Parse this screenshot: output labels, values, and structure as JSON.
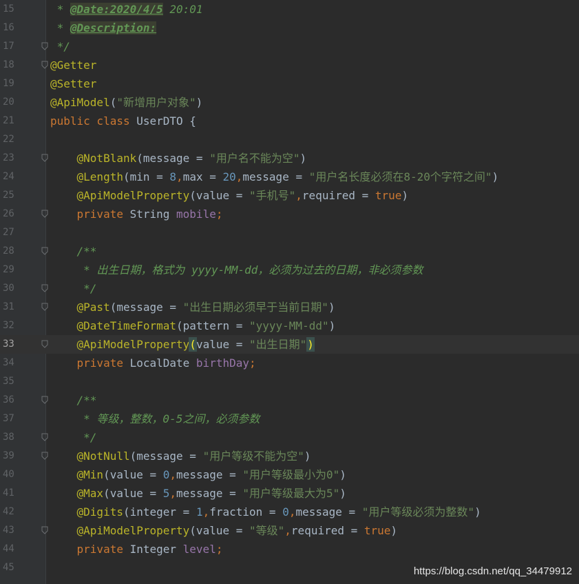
{
  "editor": {
    "current_line": "33",
    "lines": [
      {
        "n": "15",
        "t": [
          [
            "cmt",
            " * "
          ],
          [
            "tag",
            "@Date:2020/4/5"
          ],
          [
            "cmt",
            " 20:01"
          ]
        ]
      },
      {
        "n": "16",
        "t": [
          [
            "cmt",
            " * "
          ],
          [
            "tag",
            "@Description:"
          ]
        ]
      },
      {
        "n": "17",
        "t": [
          [
            "cmt",
            " */"
          ]
        ]
      },
      {
        "n": "18",
        "t": [
          [
            "ann",
            "@Getter"
          ]
        ]
      },
      {
        "n": "19",
        "t": [
          [
            "ann",
            "@Setter"
          ]
        ]
      },
      {
        "n": "20",
        "t": [
          [
            "ann",
            "@ApiModel"
          ],
          [
            "plain",
            "("
          ],
          [
            "str",
            "\"新增用户对象\""
          ],
          [
            "plain",
            ")"
          ]
        ]
      },
      {
        "n": "21",
        "t": [
          [
            "kw",
            "public class "
          ],
          [
            "plain",
            "UserDTO {"
          ]
        ]
      },
      {
        "n": "22",
        "t": []
      },
      {
        "n": "23",
        "t": [
          [
            "plain",
            "    "
          ],
          [
            "ann",
            "@NotBlank"
          ],
          [
            "plain",
            "(message = "
          ],
          [
            "str",
            "\"用户名不能为空\""
          ],
          [
            "plain",
            ")"
          ]
        ]
      },
      {
        "n": "24",
        "t": [
          [
            "plain",
            "    "
          ],
          [
            "ann",
            "@Length"
          ],
          [
            "plain",
            "(min = "
          ],
          [
            "num",
            "8"
          ],
          [
            "kw",
            ","
          ],
          [
            "plain",
            "max = "
          ],
          [
            "num",
            "20"
          ],
          [
            "kw",
            ","
          ],
          [
            "plain",
            "message = "
          ],
          [
            "str",
            "\"用户名长度必须在8-20个字符之间\""
          ],
          [
            "plain",
            ")"
          ]
        ]
      },
      {
        "n": "25",
        "t": [
          [
            "plain",
            "    "
          ],
          [
            "ann",
            "@ApiModelProperty"
          ],
          [
            "plain",
            "(value = "
          ],
          [
            "str",
            "\"手机号\""
          ],
          [
            "kw",
            ","
          ],
          [
            "plain",
            "required = "
          ],
          [
            "kw",
            "true"
          ],
          [
            "plain",
            ")"
          ]
        ]
      },
      {
        "n": "26",
        "t": [
          [
            "plain",
            "    "
          ],
          [
            "kw",
            "private "
          ],
          [
            "plain",
            "String "
          ],
          [
            "fld",
            "mobile"
          ],
          [
            "kw",
            ";"
          ]
        ]
      },
      {
        "n": "27",
        "t": []
      },
      {
        "n": "28",
        "t": [
          [
            "plain",
            "    "
          ],
          [
            "cmt",
            "/**"
          ]
        ]
      },
      {
        "n": "29",
        "t": [
          [
            "plain",
            "    "
          ],
          [
            "cmt",
            " * 出生日期，格式为 yyyy-MM-dd，必须为过去的日期，非必须参数"
          ]
        ]
      },
      {
        "n": "30",
        "t": [
          [
            "plain",
            "    "
          ],
          [
            "cmt",
            " */"
          ]
        ]
      },
      {
        "n": "31",
        "t": [
          [
            "plain",
            "    "
          ],
          [
            "ann",
            "@Past"
          ],
          [
            "plain",
            "(message = "
          ],
          [
            "str",
            "\"出生日期必须早于当前日期\""
          ],
          [
            "plain",
            ")"
          ]
        ]
      },
      {
        "n": "32",
        "t": [
          [
            "plain",
            "    "
          ],
          [
            "ann",
            "@DateTimeFormat"
          ],
          [
            "plain",
            "(pattern = "
          ],
          [
            "str",
            "\"yyyy-MM-dd\""
          ],
          [
            "plain",
            ")"
          ]
        ]
      },
      {
        "n": "33",
        "t": [
          [
            "plain",
            "    "
          ],
          [
            "ann",
            "@ApiModelProperty"
          ],
          [
            "brace",
            "("
          ],
          [
            "plain",
            "value = "
          ],
          [
            "str",
            "\"出生日期\""
          ],
          [
            "caret",
            ""
          ],
          [
            "brace",
            ")"
          ]
        ]
      },
      {
        "n": "34",
        "t": [
          [
            "plain",
            "    "
          ],
          [
            "kw",
            "private "
          ],
          [
            "plain",
            "LocalDate "
          ],
          [
            "fld",
            "birthDay"
          ],
          [
            "kw",
            ";"
          ]
        ]
      },
      {
        "n": "35",
        "t": []
      },
      {
        "n": "36",
        "t": [
          [
            "plain",
            "    "
          ],
          [
            "cmt",
            "/**"
          ]
        ]
      },
      {
        "n": "37",
        "t": [
          [
            "plain",
            "    "
          ],
          [
            "cmt",
            " * 等级，整数，0-5之间，必须参数"
          ]
        ]
      },
      {
        "n": "38",
        "t": [
          [
            "plain",
            "    "
          ],
          [
            "cmt",
            " */"
          ]
        ]
      },
      {
        "n": "39",
        "t": [
          [
            "plain",
            "    "
          ],
          [
            "ann",
            "@NotNull"
          ],
          [
            "plain",
            "(message = "
          ],
          [
            "str",
            "\"用户等级不能为空\""
          ],
          [
            "plain",
            ")"
          ]
        ]
      },
      {
        "n": "40",
        "t": [
          [
            "plain",
            "    "
          ],
          [
            "ann",
            "@Min"
          ],
          [
            "plain",
            "(value = "
          ],
          [
            "num",
            "0"
          ],
          [
            "kw",
            ","
          ],
          [
            "plain",
            "message = "
          ],
          [
            "str",
            "\"用户等级最小为0\""
          ],
          [
            "plain",
            ")"
          ]
        ]
      },
      {
        "n": "41",
        "t": [
          [
            "plain",
            "    "
          ],
          [
            "ann",
            "@Max"
          ],
          [
            "plain",
            "(value = "
          ],
          [
            "num",
            "5"
          ],
          [
            "kw",
            ","
          ],
          [
            "plain",
            "message = "
          ],
          [
            "str",
            "\"用户等级最大为5\""
          ],
          [
            "plain",
            ")"
          ]
        ]
      },
      {
        "n": "42",
        "t": [
          [
            "plain",
            "    "
          ],
          [
            "ann",
            "@Digits"
          ],
          [
            "plain",
            "(integer = "
          ],
          [
            "num",
            "1"
          ],
          [
            "kw",
            ","
          ],
          [
            "plain",
            "fraction = "
          ],
          [
            "num",
            "0"
          ],
          [
            "kw",
            ","
          ],
          [
            "plain",
            "message = "
          ],
          [
            "str",
            "\"用户等级必须为整数\""
          ],
          [
            "plain",
            ")"
          ]
        ]
      },
      {
        "n": "43",
        "t": [
          [
            "plain",
            "    "
          ],
          [
            "ann",
            "@ApiModelProperty"
          ],
          [
            "plain",
            "(value = "
          ],
          [
            "str",
            "\"等级\""
          ],
          [
            "kw",
            ","
          ],
          [
            "plain",
            "required = "
          ],
          [
            "kw",
            "true"
          ],
          [
            "plain",
            ")"
          ]
        ]
      },
      {
        "n": "44",
        "t": [
          [
            "plain",
            "    "
          ],
          [
            "kw",
            "private "
          ],
          [
            "plain",
            "Integer "
          ],
          [
            "fld",
            "level"
          ],
          [
            "kw",
            ";"
          ]
        ]
      },
      {
        "n": "45",
        "t": []
      }
    ],
    "fold_markers": [
      "17",
      "18",
      "23",
      "26",
      "28",
      "30",
      "31",
      "33",
      "36",
      "38",
      "39",
      "43"
    ]
  },
  "watermark": "https://blog.csdn.net/qq_34479912",
  "colors": {
    "background": "#2b2b2b",
    "gutter": "#313335",
    "annotation": "#bbb529",
    "keyword": "#cc7832",
    "string": "#6a8759",
    "number": "#6897bb",
    "field": "#9876aa",
    "comment": "#629755"
  }
}
